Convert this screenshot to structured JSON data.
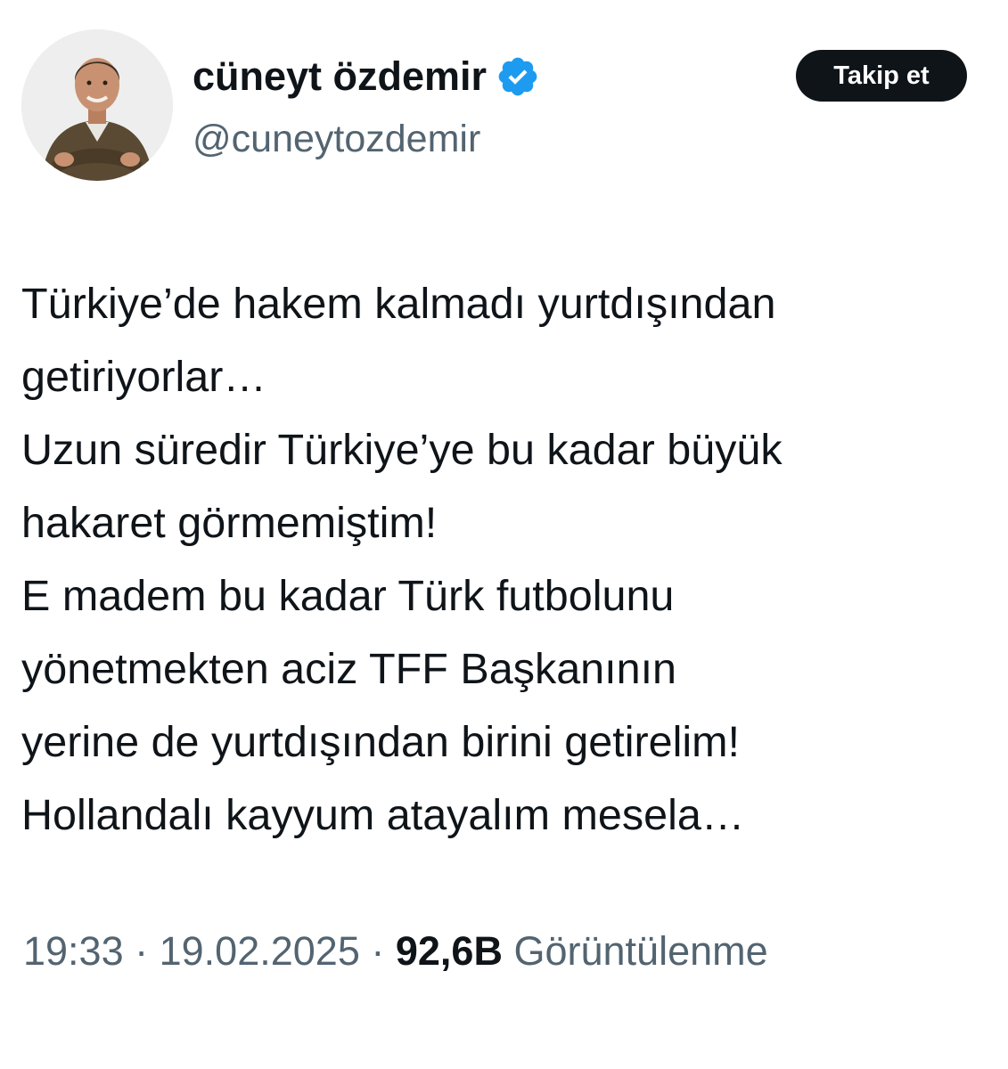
{
  "author": {
    "display_name": "cüneyt özdemir",
    "handle": "@cuneytozdemir",
    "verified": true,
    "verified_color": "#1d9bf0"
  },
  "follow_button": {
    "label": "Takip et"
  },
  "tweet": {
    "lines": [
      "Türkiye’de hakem kalmadı yurtdışından",
      "getiriyorlar…",
      "Uzun süredir Türkiye’ye bu kadar büyük",
      "hakaret görmemiştim!",
      "E madem bu kadar Türk futbolunu",
      "yönetmekten aciz TFF Başkanının",
      "yerine de yurtdışından birini getirelim!",
      "Hollandalı kayyum atayalım mesela…"
    ]
  },
  "meta": {
    "time": "19:33",
    "separator": " · ",
    "date": "19.02.2025",
    "views_count": "92,6B",
    "views_label": "Görüntülenme"
  }
}
